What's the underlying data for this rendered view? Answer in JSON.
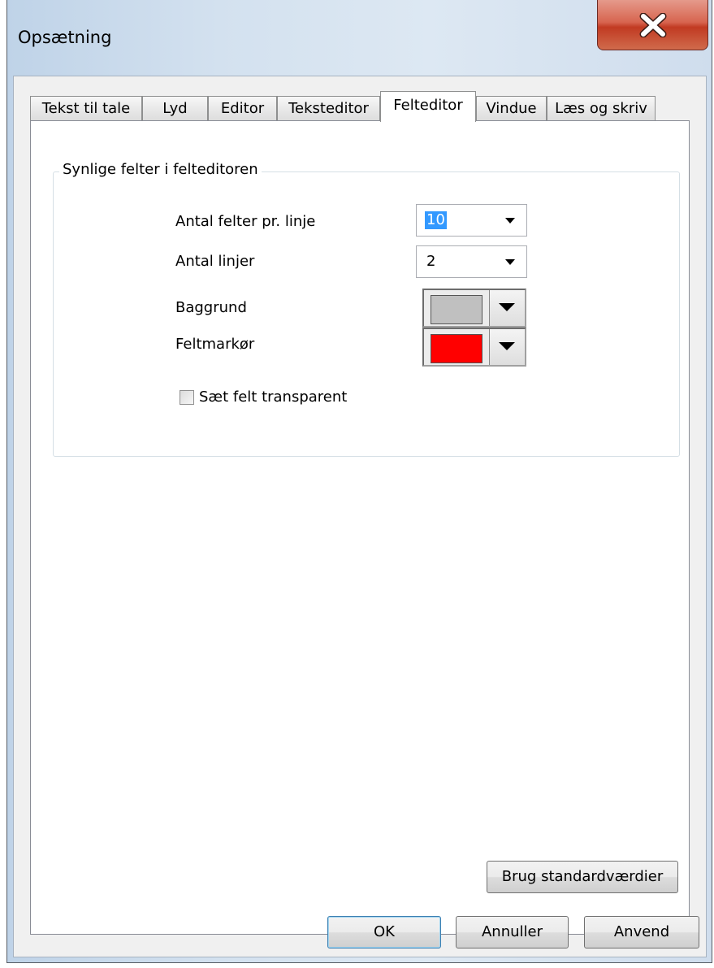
{
  "window": {
    "title": "Opsætning"
  },
  "tabs": [
    {
      "label": "Tekst til tale"
    },
    {
      "label": "Lyd"
    },
    {
      "label": "Editor"
    },
    {
      "label": "Teksteditor"
    },
    {
      "label": "Felteditor",
      "active": true
    },
    {
      "label": "Vindue"
    },
    {
      "label": "Læs og skriv"
    }
  ],
  "group": {
    "title": "Synlige felter i felteditoren",
    "fields_per_line": {
      "label": "Antal felter pr. linje",
      "value": "10"
    },
    "lines": {
      "label": "Antal linjer",
      "value": "2"
    },
    "background": {
      "label": "Baggrund",
      "color": "#c0c0c0"
    },
    "field_marker": {
      "label": "Feltmarkør",
      "color": "#ff0000"
    },
    "transparent": {
      "label": "Sæt felt transparent",
      "checked": false
    }
  },
  "buttons": {
    "defaults": "Brug standardværdier",
    "ok": "OK",
    "cancel": "Annuller",
    "apply": "Anvend"
  },
  "icons": {
    "close": "close-x-icon",
    "dropdown": "chevron-down-icon"
  }
}
